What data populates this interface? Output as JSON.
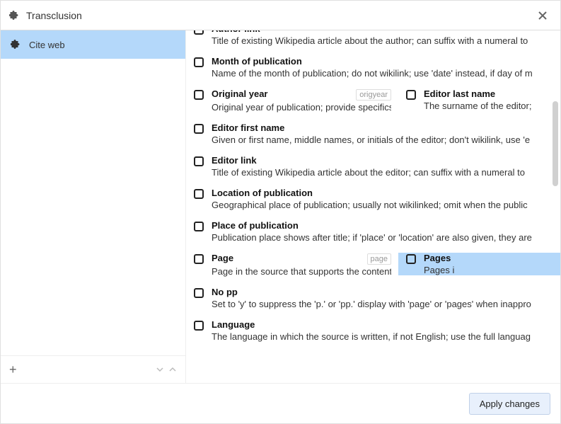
{
  "header": {
    "title": "Transclusion"
  },
  "sidebar": {
    "items": [
      "Cite web"
    ],
    "add_label": "+"
  },
  "params": [
    {
      "label": "Author link",
      "desc": "Title of existing Wikipedia article about the author; can suffix with a numeral to",
      "truncated_top": true
    },
    {
      "label": "Month of publication",
      "desc": "Name of the month of publication; do not wikilink; use 'date' instead, if day of m"
    },
    {
      "pair": true,
      "left": {
        "label": "Original year",
        "alias": "origyear",
        "desc": "Original year of publication; provide specifics"
      },
      "right": {
        "label": "Editor last name",
        "desc": "The surname of the editor;"
      }
    },
    {
      "label": "Editor first name",
      "desc": "Given or first name, middle names, or initials of the editor; don't wikilink, use 'e"
    },
    {
      "label": "Editor link",
      "desc": "Title of existing Wikipedia article about the editor; can suffix with a numeral to"
    },
    {
      "label": "Location of publication",
      "desc": "Geographical place of publication; usually not wikilinked; omit when the public"
    },
    {
      "label": "Place of publication",
      "desc": "Publication place shows after title; if 'place' or 'location' are also given, they are"
    },
    {
      "pair": true,
      "left": {
        "label": "Page",
        "alias": "page",
        "desc": "Page in the source that supports the content; displays after 'p.'"
      },
      "right": {
        "label": "Pages",
        "desc": "Pages i",
        "highlight": true
      }
    },
    {
      "label": "No pp",
      "desc": "Set to 'y' to suppress the 'p.' or 'pp.' display with 'page' or 'pages' when inappro"
    },
    {
      "label": "Language",
      "desc": "The language in which the source is written, if not English; use the full languag"
    }
  ],
  "footer": {
    "apply_label": "Apply changes"
  }
}
